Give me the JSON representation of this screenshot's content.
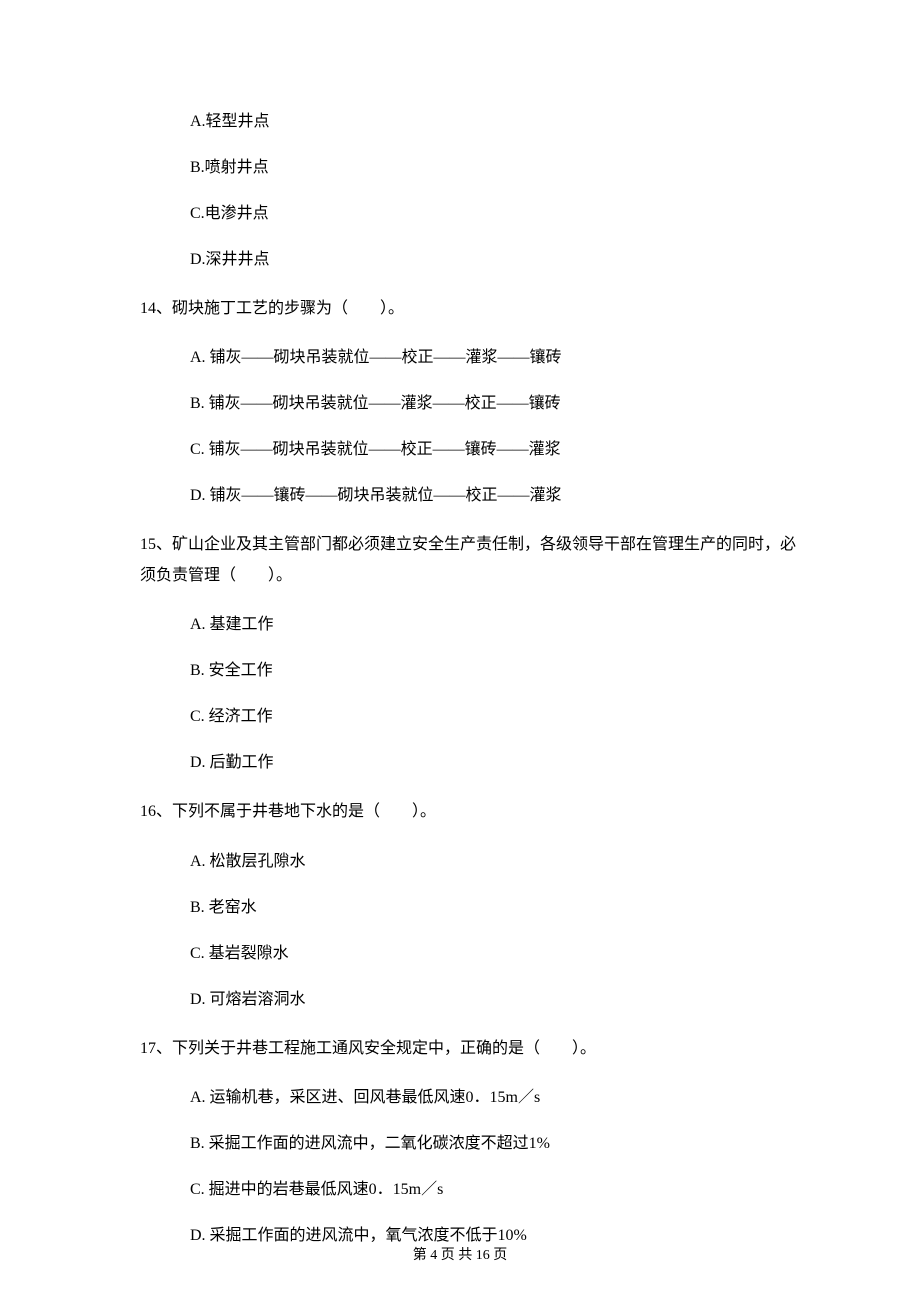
{
  "q13_options": {
    "a": "A.轻型井点",
    "b": "B.喷射井点",
    "c": "C.电渗井点",
    "d": "D.深井井点"
  },
  "q14": {
    "text": "14、砌块施丁工艺的步骤为（　　）。",
    "a": "A. 铺灰——砌块吊装就位——校正——灌浆——镶砖",
    "b": "B. 铺灰——砌块吊装就位——灌浆——校正——镶砖",
    "c": "C. 铺灰——砌块吊装就位——校正——镶砖——灌浆",
    "d": "D. 铺灰——镶砖——砌块吊装就位——校正——灌浆"
  },
  "q15": {
    "text": "15、矿山企业及其主管部门都必须建立安全生产责任制，各级领导干部在管理生产的同时，必须负责管理（　　）。",
    "a": "A. 基建工作",
    "b": "B. 安全工作",
    "c": "C. 经济工作",
    "d": "D. 后勤工作"
  },
  "q16": {
    "text": "16、下列不属于井巷地下水的是（　　）。",
    "a": "A. 松散层孔隙水",
    "b": "B. 老窑水",
    "c": "C. 基岩裂隙水",
    "d": "D. 可熔岩溶洞水"
  },
  "q17": {
    "text": "17、下列关于井巷工程施工通风安全规定中，正确的是（　　）。",
    "a": "A. 运输机巷，采区进、回风巷最低风速0．15m／s",
    "b": "B. 采掘工作面的进风流中，二氧化碳浓度不超过1%",
    "c": "C. 掘进中的岩巷最低风速0．15m／s",
    "d": "D. 采掘工作面的进风流中，氧气浓度不低于10%"
  },
  "footer": "第 4 页 共 16 页"
}
